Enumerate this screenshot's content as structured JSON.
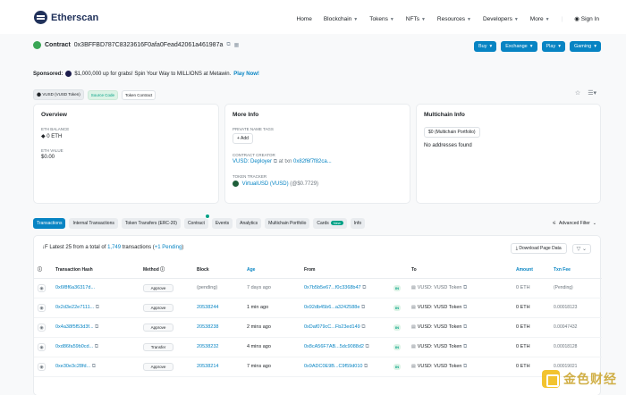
{
  "brand": {
    "name": "Etherscan"
  },
  "nav": {
    "items": [
      {
        "label": "Home",
        "caret": false
      },
      {
        "label": "Blockchain",
        "caret": true
      },
      {
        "label": "Tokens",
        "caret": true
      },
      {
        "label": "NFTs",
        "caret": true
      },
      {
        "label": "Resources",
        "caret": true
      },
      {
        "label": "Developers",
        "caret": true
      },
      {
        "label": "More",
        "caret": true
      }
    ],
    "signin": "Sign In"
  },
  "contract": {
    "label": "Contract",
    "address": "0x3BFFBD787C8323616F0afa0Fead42061a461987a"
  },
  "action_buttons": [
    "Buy",
    "Exchange",
    "Play",
    "Gaming"
  ],
  "sponsored": {
    "prefix": "Sponsored:",
    "text": "$1,000,000 up for grabs! Spin Your Way to MILLIONS at Metawin.",
    "link": "Play Now!"
  },
  "tags": [
    "VUSD (VUSD Token)",
    "Source Code",
    "Token Contract"
  ],
  "overview": {
    "title": "Overview",
    "eth_balance_label": "ETH BALANCE",
    "eth_balance": "0 ETH",
    "eth_value_label": "ETH VALUE",
    "eth_value": "$0.00"
  },
  "more_info": {
    "title": "More Info",
    "private_tags_label": "PRIVATE NAME TAGS",
    "add_label": "+ Add",
    "creator_label": "CONTRACT CREATOR",
    "creator": "VUSD: Deployer",
    "creator_tx_prefix": "at txn",
    "creator_tx": "0x82f6f7f82ca...",
    "tracker_label": "TOKEN TRACKER",
    "tracker": "VirtualUSD (VUSD)",
    "tracker_price": "(@$0.7729)"
  },
  "multichain": {
    "title": "Multichain Info",
    "portfolio_btn": "$0 (Multichain Portfolio)",
    "no_addresses": "No addresses found"
  },
  "tabs": [
    "Transactions",
    "Internal Transactions",
    "Token Transfers (ERC-20)",
    "Contract",
    "Events",
    "Analytics",
    "Multichain Portfolio",
    "Cards",
    "Info"
  ],
  "cards_pill": "New",
  "advanced_filter": "Advanced Filter",
  "txn_summary": {
    "prefix": "Latest 25 from a total of",
    "total": "1,749",
    "mid": "transactions (",
    "pending": "+1 Pending",
    "suffix": ")"
  },
  "download_btn": "Download Page Data",
  "table": {
    "headers": [
      "",
      "Transaction Hash",
      "Method",
      "Block",
      "Age",
      "From",
      "",
      "To",
      "Amount",
      "Txn Fee"
    ],
    "rows": [
      {
        "hash": "0x6f8f6a36317d...",
        "method": "Approve",
        "block": "(pending)",
        "age": "7 days ago",
        "from": "0x7b5b5e67...f0c3368b47",
        "dir": "IN",
        "to": "VUSD: VUSD Token",
        "amount": "0 ETH",
        "fee": "(Pending)"
      },
      {
        "hash": "0x2d3e22e7111...",
        "method": "Approve",
        "block": "20538244",
        "age": "1 min ago",
        "from": "0x92db45b6...a3242588e",
        "dir": "IN",
        "to": "VUSD: VUSD Token",
        "amount": "0 ETH",
        "fee": "0.00018123"
      },
      {
        "hash": "0x4a38f5f53d3f...",
        "method": "Approve",
        "block": "20538238",
        "age": "2 mins ago",
        "from": "0xDaf079cC...Fb23ed149",
        "dir": "IN",
        "to": "VUSD: VUSD Token",
        "amount": "0 ETH",
        "fee": "0.00047432"
      },
      {
        "hash": "0xd86fa59b0cd...",
        "method": "Transfer",
        "block": "20538232",
        "age": "4 mins ago",
        "from": "0x8cA56F7AB...5dc9088d2",
        "dir": "IN",
        "to": "VUSD: VUSD Token",
        "amount": "0 ETH",
        "fee": "0.00018128"
      },
      {
        "hash": "0xe30e3c28fd...",
        "method": "Approve",
        "block": "20538214",
        "age": "7 mins ago",
        "from": "0x9ADC0E9B...C9f59d010",
        "dir": "IN",
        "to": "VUSD: VUSD Token",
        "amount": "0 ETH",
        "fee": "0.00019021"
      }
    ]
  },
  "watermark": {
    "text": "金色财经"
  },
  "colors": {
    "brand_blue": "#0784c3",
    "navy": "#21325b",
    "green": "#00a186"
  }
}
